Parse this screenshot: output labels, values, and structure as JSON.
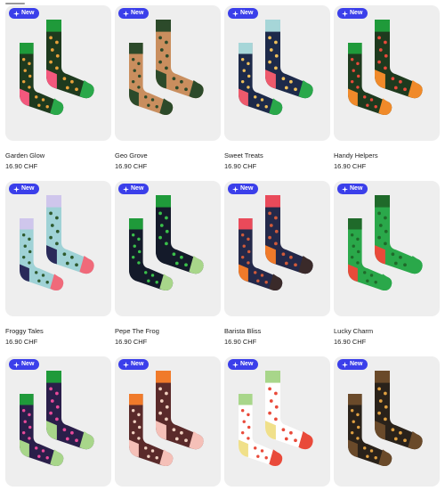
{
  "badge_label": "New",
  "products": [
    {
      "name": "Garden Glow",
      "price": "16.90 CHF",
      "cuff": "#1f9a3a",
      "body": "#1e3a1e",
      "heel": "#f3587d",
      "toe": "#2aa84a",
      "pattern": "#e8a13a"
    },
    {
      "name": "Geo Grove",
      "price": "16.90 CHF",
      "cuff": "#2c4a2a",
      "body": "#c98e5e",
      "heel": "#2c4a2a",
      "toe": "#2c4a2a",
      "pattern": "#2c4a2a"
    },
    {
      "name": "Sweet Treats",
      "price": "16.90 CHF",
      "cuff": "#a6d6d8",
      "body": "#1d2a4a",
      "heel": "#ee5a6c",
      "toe": "#2aa84a",
      "pattern": "#f0c05a"
    },
    {
      "name": "Handy Helpers",
      "price": "16.90 CHF",
      "cuff": "#1f9a3a",
      "body": "#1e3a1e",
      "heel": "#f08a2a",
      "toe": "#f08a2a",
      "pattern": "#e94a3a"
    },
    {
      "name": "Froggy Tales",
      "price": "16.90 CHF",
      "cuff": "#cfc6ec",
      "body": "#9fd2d6",
      "heel": "#2a2a5a",
      "toe": "#f06a7a",
      "pattern": "#2e5a2e"
    },
    {
      "name": "Pepe The Frog",
      "price": "16.90 CHF",
      "cuff": "#1f9a3a",
      "body": "#141a2a",
      "heel": "#141a2a",
      "toe": "#a8d68a",
      "pattern": "#3ac04a"
    },
    {
      "name": "Barista Bliss",
      "price": "16.90 CHF",
      "cuff": "#e94a5a",
      "body": "#24294a",
      "heel": "#f07a2a",
      "toe": "#3a2a2a",
      "pattern": "#d05a3a"
    },
    {
      "name": "Lucky Charm",
      "price": "16.90 CHF",
      "cuff": "#1f6a2a",
      "body": "#2aa84a",
      "heel": "#e94a3a",
      "toe": "#2aa84a",
      "pattern": "#1f6a2a"
    },
    {
      "name": "",
      "price": "",
      "cuff": "#1f9a3a",
      "body": "#2a1f4a",
      "heel": "#a8d68a",
      "toe": "#a8d68a",
      "pattern": "#e94a9a"
    },
    {
      "name": "",
      "price": "",
      "cuff": "#f07a2a",
      "body": "#5a2a2a",
      "heel": "#f5c0b8",
      "toe": "#f5c0b8",
      "pattern": "#f0d0c0"
    },
    {
      "name": "",
      "price": "",
      "cuff": "#a8d68a",
      "body": "#ffffff",
      "heel": "#f0e08a",
      "toe": "#e94a3a",
      "pattern": "#e94a3a"
    },
    {
      "name": "",
      "price": "",
      "cuff": "#6a4a2a",
      "body": "#2a221a",
      "heel": "#6a4a2a",
      "toe": "#6a4a2a",
      "pattern": "#e0a040"
    }
  ]
}
